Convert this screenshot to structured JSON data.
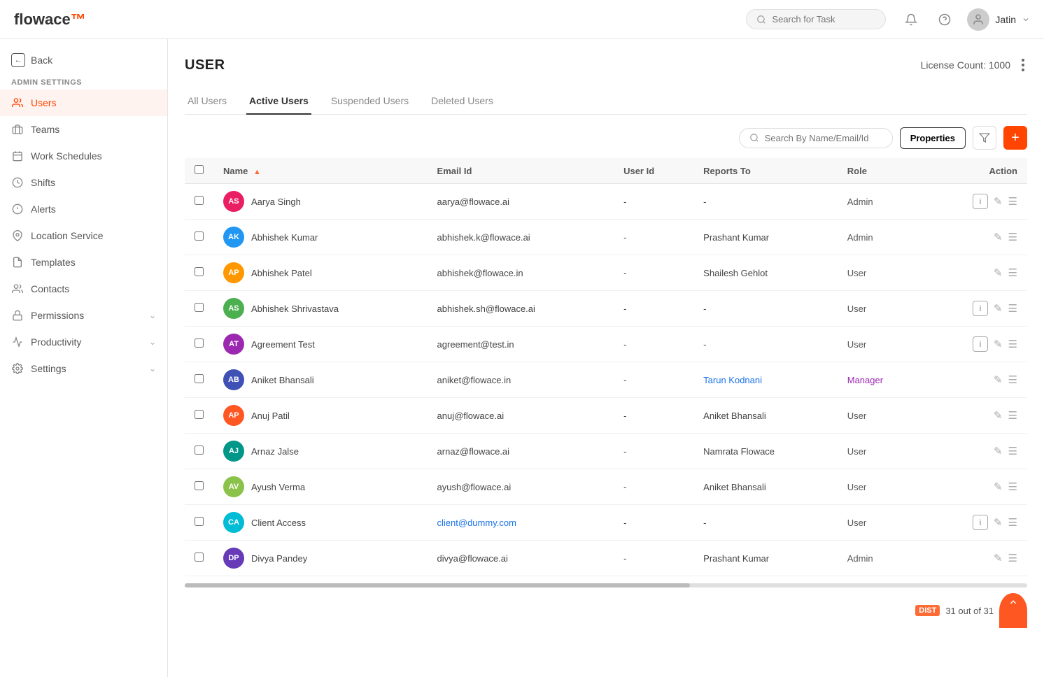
{
  "app": {
    "logo_text": "flowace",
    "logo_accent": "™"
  },
  "topbar": {
    "search_placeholder": "Search for Task",
    "user_name": "Jatin"
  },
  "sidebar": {
    "back_label": "Back",
    "admin_label": "ADMIN SETTINGS",
    "nav_items": [
      {
        "id": "users",
        "label": "Users",
        "active": true
      },
      {
        "id": "teams",
        "label": "Teams",
        "active": false
      },
      {
        "id": "work-schedules",
        "label": "Work Schedules",
        "active": false
      },
      {
        "id": "shifts",
        "label": "Shifts",
        "active": false
      },
      {
        "id": "alerts",
        "label": "Alerts",
        "active": false
      },
      {
        "id": "location-service",
        "label": "Location Service",
        "active": false
      },
      {
        "id": "templates",
        "label": "Templates",
        "active": false
      },
      {
        "id": "contacts",
        "label": "Contacts",
        "active": false
      },
      {
        "id": "permissions",
        "label": "Permissions",
        "active": false,
        "has_chevron": true
      },
      {
        "id": "productivity",
        "label": "Productivity",
        "active": false,
        "has_chevron": true
      },
      {
        "id": "settings",
        "label": "Settings",
        "active": false,
        "has_chevron": true
      }
    ]
  },
  "page": {
    "title": "USER",
    "license_label": "License Count: 1000",
    "tabs": [
      {
        "id": "all-users",
        "label": "All Users",
        "active": false
      },
      {
        "id": "active-users",
        "label": "Active Users",
        "active": true
      },
      {
        "id": "suspended-users",
        "label": "Suspended Users",
        "active": false
      },
      {
        "id": "deleted-users",
        "label": "Deleted Users",
        "active": false
      }
    ],
    "search_placeholder": "Search By Name/Email/Id",
    "properties_label": "Properties",
    "add_label": "+",
    "pagination": "31 out of 31",
    "dist_label": "DIST"
  },
  "table": {
    "columns": [
      "Name",
      "Email Id",
      "User Id",
      "Reports To",
      "Role",
      "Action"
    ],
    "rows": [
      {
        "id": 1,
        "avatar_initials": "AS",
        "avatar_color": "#e91e63",
        "name": "Aarya Singh",
        "email": "aarya@flowace.ai",
        "user_id": "-",
        "reports_to": "-",
        "role": "Admin",
        "role_type": "admin",
        "has_info": true
      },
      {
        "id": 2,
        "avatar_initials": "AK",
        "avatar_color": "#2196f3",
        "name": "Abhishek Kumar",
        "email": "abhishek.k@flowace.ai",
        "user_id": "-",
        "reports_to": "Prashant Kumar",
        "role": "Admin",
        "role_type": "admin",
        "has_info": false
      },
      {
        "id": 3,
        "avatar_initials": "AP",
        "avatar_color": "#ff9800",
        "name": "Abhishek Patel",
        "email": "abhishek@flowace.in",
        "user_id": "-",
        "reports_to": "Shailesh Gehlot",
        "role": "User",
        "role_type": "user",
        "has_info": false
      },
      {
        "id": 4,
        "avatar_initials": "AS",
        "avatar_color": "#4caf50",
        "name": "Abhishek Shrivastava",
        "email": "abhishek.sh@flowace.ai",
        "user_id": "-",
        "reports_to": "-",
        "role": "User",
        "role_type": "user",
        "has_info": true
      },
      {
        "id": 5,
        "avatar_initials": "AT",
        "avatar_color": "#9c27b0",
        "name": "Agreement Test",
        "email": "agreement@test.in",
        "user_id": "-",
        "reports_to": "-",
        "role": "User",
        "role_type": "user",
        "has_info": true
      },
      {
        "id": 6,
        "avatar_initials": "AB",
        "avatar_color": "#3f51b5",
        "name": "Aniket Bhansali",
        "email": "aniket@flowace.in",
        "user_id": "-",
        "reports_to": "Tarun Kodnani",
        "role": "Manager",
        "role_type": "manager",
        "reports_to_link": true,
        "has_info": false
      },
      {
        "id": 7,
        "avatar_initials": "AP",
        "avatar_color": "#ff5722",
        "name": "Anuj Patil",
        "email": "anuj@flowace.ai",
        "user_id": "-",
        "reports_to": "Aniket Bhansali",
        "role": "User",
        "role_type": "user",
        "has_info": false
      },
      {
        "id": 8,
        "avatar_initials": "AJ",
        "avatar_color": "#009688",
        "name": "Arnaz Jalse",
        "email": "arnaz@flowace.ai",
        "user_id": "-",
        "reports_to": "Namrata Flowace",
        "role": "User",
        "role_type": "user",
        "has_info": false
      },
      {
        "id": 9,
        "avatar_initials": "AV",
        "avatar_color": "#8bc34a",
        "name": "Ayush Verma",
        "email": "ayush@flowace.ai",
        "user_id": "-",
        "reports_to": "Aniket Bhansali",
        "role": "User",
        "role_type": "user",
        "has_info": false
      },
      {
        "id": 10,
        "avatar_initials": "CA",
        "avatar_color": "#00bcd4",
        "name": "Client Access",
        "email": "client@dummy.com",
        "user_id": "-",
        "reports_to": "-",
        "role": "User",
        "role_type": "user",
        "email_link": true,
        "has_info": true
      },
      {
        "id": 11,
        "avatar_initials": "DP",
        "avatar_color": "#673ab7",
        "name": "Divya Pandey",
        "email": "divya@flowace.ai",
        "user_id": "-",
        "reports_to": "Prashant Kumar",
        "role": "Admin",
        "role_type": "admin",
        "has_info": false
      }
    ]
  }
}
